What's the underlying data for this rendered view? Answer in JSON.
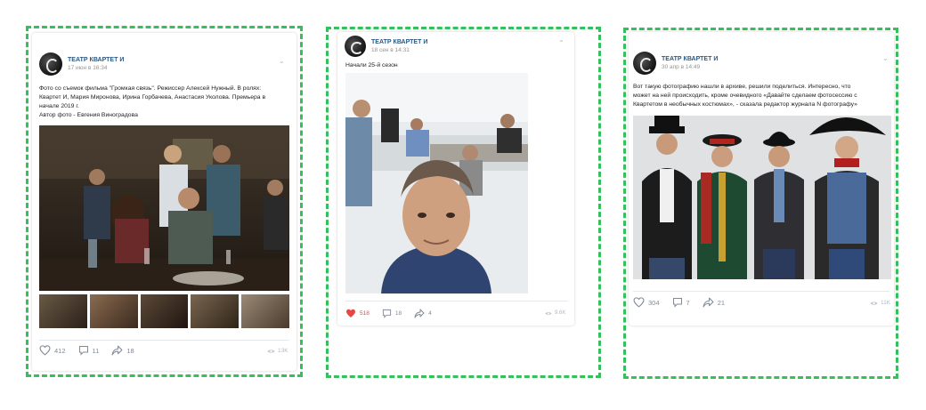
{
  "posts": [
    {
      "author": "ТЕАТР КВАРТЕТ И",
      "date": "17 июн в 16:34",
      "text_lines": [
        "Фото со съемок фильма \"Громкая связь\". Режиссер Алексей Нужный. В ролях:",
        "Квартет И, Мария Миронова, Ирина Горбачева, Анастасия Уколова. Премьера в",
        "начале 2019 г.",
        "Автор фото - Евгения Виноградова"
      ],
      "likes": "412",
      "comments": "11",
      "reposts": "18",
      "views": "13K",
      "thumb_count": 5
    },
    {
      "author": "ТЕАТР КВАРТЕТ И",
      "date": "18 сен в 14:31",
      "text_lines": [
        "Начали 25-й сезон"
      ],
      "likes": "518",
      "comments": "18",
      "reposts": "4",
      "views": "9.6K",
      "liked": true
    },
    {
      "author": "ТЕАТР КВАРТЕТ И",
      "date": "30 апр в 14:49",
      "text_lines": [
        "Вот такую фотографию нашли в архиве, решили поделиться. Интересно, что",
        "может на ней происходить, кроме очевидного «Давайте сделаем фотосессию с",
        "Квартетом в необычных костюмах», - сказала редактор журнала N фотографу»"
      ],
      "likes": "304",
      "comments": "7",
      "reposts": "21",
      "views": "11K"
    }
  ],
  "colors": {
    "frame": "#35c05c",
    "link": "#2a5885",
    "like_active": "#e64646",
    "muted": "#828a99"
  },
  "icons": [
    "chevron-down-icon",
    "heart-icon",
    "comment-icon",
    "share-icon",
    "eye-icon"
  ]
}
